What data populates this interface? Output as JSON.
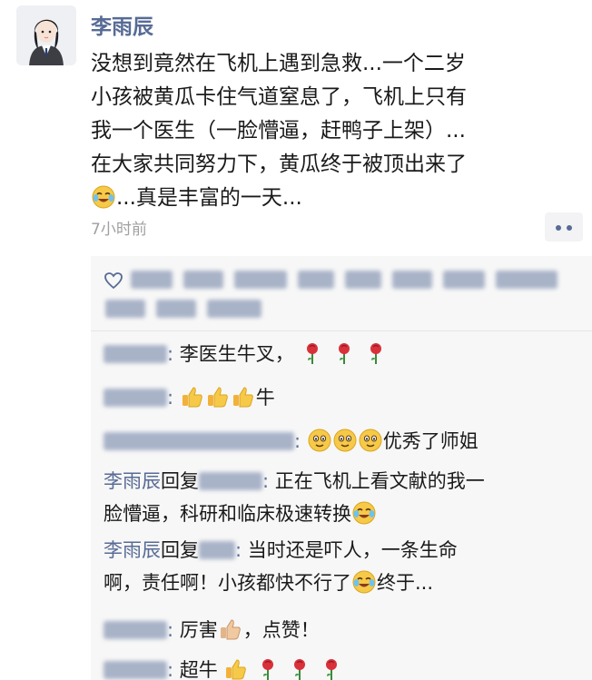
{
  "post": {
    "author": "李雨辰",
    "lines": [
      "没想到竟然在飞机上遇到急救...一个二岁",
      "小孩被黄瓜卡住气道窒息了，飞机上只有",
      "我一个医生（一脸懵逼，赶鸭子上架）...",
      "在大家共同努力下，黄瓜终于被顶出来了"
    ],
    "last_line": "...真是丰富的一天...",
    "time": "7小时前"
  },
  "comments": {
    "c1_text": "李医生牛叉，",
    "c2_text": "牛",
    "c3_text": "优秀了师姐",
    "c4_author": "李雨辰",
    "c4_reply_word": "回复",
    "c4_line1": "正在飞机上看文献的我一",
    "c4_line2": "脸懵逼，科研和临床极速转换",
    "c5_author": "李雨辰",
    "c5_reply_word": "回复",
    "c5_line1": "当时还是吓人，一条生命",
    "c5_line2": "啊，责任啊！小孩都快不行了",
    "c5_line2_end": "终于...",
    "c6_text": "厉害",
    "c6_end": "，点赞！",
    "c7_text": "超牛"
  },
  "colors": {
    "link": "#576b95",
    "comment_bg": "#f7f7f7"
  },
  "icons": {
    "heart": "heart-outline-icon",
    "emoji_cry_laugh": "tears-of-joy-emoji",
    "rose": "rose-emoji",
    "thumbs_up": "thumbs-up-emoji",
    "smile": "smiling-face-emoji"
  }
}
